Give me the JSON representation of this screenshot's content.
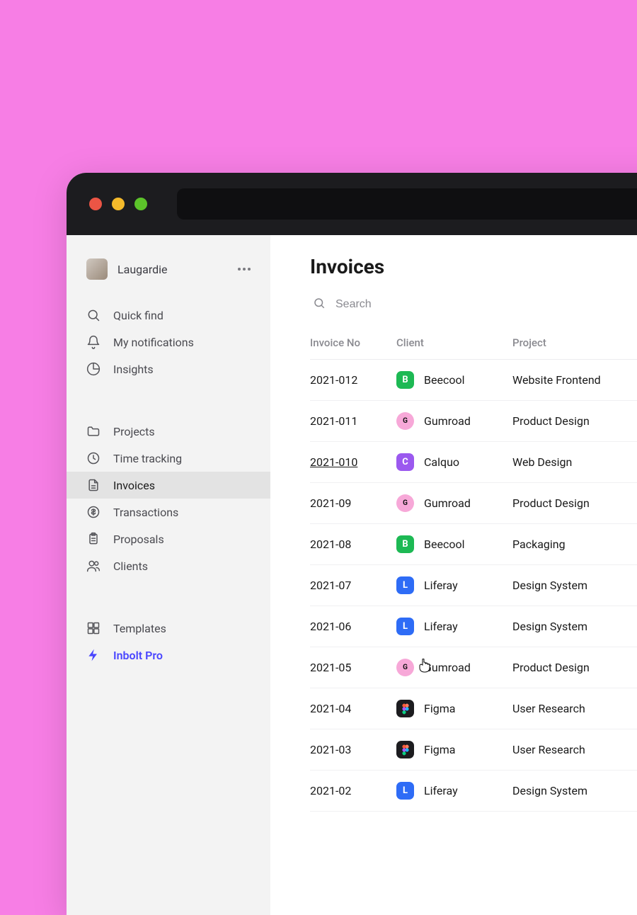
{
  "profile": {
    "name": "Laugardie"
  },
  "nav": {
    "group1": [
      {
        "icon": "search",
        "label": "Quick find"
      },
      {
        "icon": "bell",
        "label": "My notifications"
      },
      {
        "icon": "pie",
        "label": "Insights"
      }
    ],
    "group2": [
      {
        "icon": "folder",
        "label": "Projects"
      },
      {
        "icon": "clock",
        "label": "Time tracking"
      },
      {
        "icon": "file",
        "label": "Invoices",
        "active": true
      },
      {
        "icon": "dollar",
        "label": "Transactions"
      },
      {
        "icon": "clipboard",
        "label": "Proposals"
      },
      {
        "icon": "users",
        "label": "Clients"
      }
    ],
    "group3": [
      {
        "icon": "templates",
        "label": "Templates"
      },
      {
        "icon": "bolt",
        "label": "Inbolt Pro",
        "pro": true
      }
    ]
  },
  "page": {
    "title": "Invoices",
    "search_placeholder": "Search",
    "columns": {
      "no": "Invoice No",
      "client": "Client",
      "project": "Project"
    },
    "hover_row": 2,
    "rows": [
      {
        "no": "2021-012",
        "client": "Beecool",
        "logo": "beecool",
        "initial": "B",
        "project": "Website Frontend"
      },
      {
        "no": "2021-011",
        "client": "Gumroad",
        "logo": "gumroad",
        "initial": "G",
        "project": "Product Design"
      },
      {
        "no": "2021-010",
        "client": "Calquo",
        "logo": "calquo",
        "initial": "C",
        "project": "Web Design"
      },
      {
        "no": "2021-09",
        "client": "Gumroad",
        "logo": "gumroad",
        "initial": "G",
        "project": "Product Design"
      },
      {
        "no": "2021-08",
        "client": "Beecool",
        "logo": "beecool",
        "initial": "B",
        "project": "Packaging"
      },
      {
        "no": "2021-07",
        "client": "Liferay",
        "logo": "liferay",
        "initial": "L",
        "project": "Design System"
      },
      {
        "no": "2021-06",
        "client": "Liferay",
        "logo": "liferay",
        "initial": "L",
        "project": "Design System"
      },
      {
        "no": "2021-05",
        "client": "Gumroad",
        "logo": "gumroad",
        "initial": "G",
        "project": "Product Design"
      },
      {
        "no": "2021-04",
        "client": "Figma",
        "logo": "figma",
        "initial": "",
        "project": "User Research"
      },
      {
        "no": "2021-03",
        "client": "Figma",
        "logo": "figma",
        "initial": "",
        "project": "User Research"
      },
      {
        "no": "2021-02",
        "client": "Liferay",
        "logo": "liferay",
        "initial": "L",
        "project": "Design System"
      }
    ]
  }
}
